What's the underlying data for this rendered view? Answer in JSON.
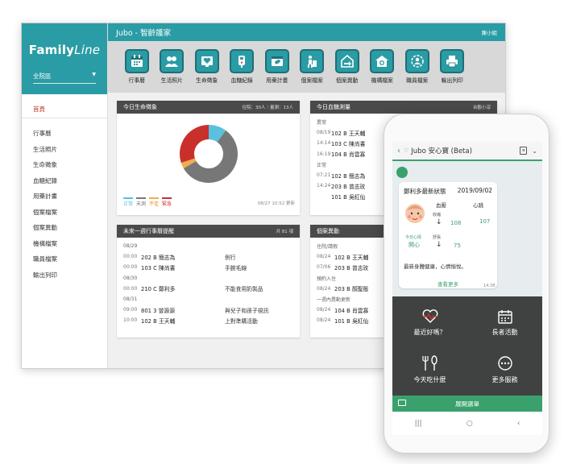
{
  "app": {
    "logo_main": "Family",
    "logo_italic": "Line",
    "ward": "全院區",
    "title": "Jubo - 智齡護家",
    "user": "陳小姐"
  },
  "sidebar": {
    "items": [
      {
        "label": "首頁"
      },
      {
        "label": "行事曆"
      },
      {
        "label": "生活照片"
      },
      {
        "label": "生命徵象"
      },
      {
        "label": "血糖紀錄"
      },
      {
        "label": "用藥計畫"
      },
      {
        "label": "個案檔案"
      },
      {
        "label": "個案異動"
      },
      {
        "label": "機構檔案"
      },
      {
        "label": "職員檔案"
      },
      {
        "label": "輸出列印"
      }
    ]
  },
  "toolbar": {
    "items": [
      {
        "label": "行事曆",
        "icon": "calendar-icon"
      },
      {
        "label": "生活照片",
        "icon": "people-photo-icon"
      },
      {
        "label": "生命徵象",
        "icon": "heart-monitor-icon"
      },
      {
        "label": "血糖紀錄",
        "icon": "glucose-meter-icon"
      },
      {
        "label": "用藥計畫",
        "icon": "medicine-plan-icon"
      },
      {
        "label": "個案檔案",
        "icon": "patient-file-icon"
      },
      {
        "label": "個案異動",
        "icon": "patient-move-icon"
      },
      {
        "label": "機構檔案",
        "icon": "institution-icon"
      },
      {
        "label": "職員檔案",
        "icon": "staff-icon"
      },
      {
        "label": "輸出列印",
        "icon": "printer-icon"
      }
    ]
  },
  "vitals_card": {
    "title": "今日生命徵象",
    "meta": "住院：30人｜量測：13人",
    "legend": [
      {
        "label": "正常",
        "color": "#5bc0de"
      },
      {
        "label": "未測",
        "color": "#777777"
      },
      {
        "label": "不佳",
        "color": "#f0ad4e"
      },
      {
        "label": "緊急",
        "color": "#c9302c"
      }
    ],
    "updated": "08/27 10:52 更新"
  },
  "chart_data": {
    "type": "pie",
    "categories": [
      "正常",
      "未測",
      "不佳",
      "緊急"
    ],
    "values": [
      3,
      17,
      1,
      9
    ],
    "colors": [
      "#5bc0de",
      "#777777",
      "#f0ad4e",
      "#c9302c"
    ]
  },
  "glucose_card": {
    "title": "今日血糖測量",
    "meta": "台觀小淳",
    "sections": [
      {
        "label": "異常",
        "rows": [
          {
            "time": "08/19",
            "resident": "102 B 王天輔"
          },
          {
            "time": "14:14",
            "resident": "103 C 陳尚書"
          },
          {
            "time": "16:19",
            "resident": "104 B 肖雲寡"
          }
        ]
      },
      {
        "label": "正常",
        "rows": [
          {
            "time": "07:21",
            "resident": "102 B 簡志為"
          },
          {
            "time": "14:24",
            "resident": "203 B 曾志玫"
          },
          {
            "time": "",
            "resident": "101 B 吳紅仙"
          }
        ]
      }
    ]
  },
  "events_card": {
    "title": "未來一週行事曆提醒",
    "meta": "共 81 項",
    "days": [
      {
        "date": "08/29",
        "rows": [
          {
            "time": "00:00",
            "resident": "202 B 簡志為",
            "event": "例行"
          },
          {
            "time": "00:00",
            "resident": "103 C 陳尚書",
            "event": "手腕毛線"
          }
        ]
      },
      {
        "date": "08/30",
        "rows": [
          {
            "time": "00:00",
            "resident": "210 C 鄭利多",
            "event": "不能食用奶製品"
          }
        ]
      },
      {
        "date": "08/31",
        "rows": [
          {
            "time": "09:00",
            "resident": "801 3 曾源源",
            "event": "與兒子和孫子視訊"
          },
          {
            "time": "10:00",
            "resident": "102 B 王天輔",
            "event": "上對準購活動"
          }
        ]
      }
    ]
  },
  "changes_card": {
    "title": "個案異動",
    "sections": [
      {
        "label": "住院/請假",
        "rows": [
          {
            "time": "08/24",
            "resident": "102 B 王天輔"
          },
          {
            "time": "07/06",
            "resident": "203 B 曾志玫"
          }
        ]
      },
      {
        "label": "預約入住",
        "rows": [
          {
            "time": "08/24",
            "resident": "203 B 顏聖殷"
          }
        ]
      },
      {
        "label": "一週內異動更新",
        "rows": [
          {
            "time": "08/24",
            "resident": "104 B 肖雲寡"
          },
          {
            "time": "08/24",
            "resident": "101 B 吳紅仙"
          }
        ]
      }
    ]
  },
  "phone": {
    "header_title": "Jubo 安心寶 (Beta)",
    "bubble_title": "鄭利多最新狀態",
    "bubble_date": "2019/09/02",
    "bp_label": "血壓",
    "hr_label": "心跳",
    "systolic_label": "收縮",
    "diastolic_label": "舒張",
    "systolic": "108",
    "diastolic": "75",
    "heart_rate": "107",
    "mood_label": "今日心情",
    "mood": "開心",
    "message": "最新身體健康，心情愉悅。",
    "more": "查看更多",
    "time": "14:38",
    "menu": [
      {
        "label": "最近好嗎？",
        "icon": "heartbeat-icon"
      },
      {
        "label": "長者活動",
        "icon": "calendar-icon"
      },
      {
        "label": "今天吃什麼",
        "icon": "utensils-icon"
      },
      {
        "label": "更多服務",
        "icon": "more-icon"
      }
    ],
    "expand": "展開選單"
  }
}
